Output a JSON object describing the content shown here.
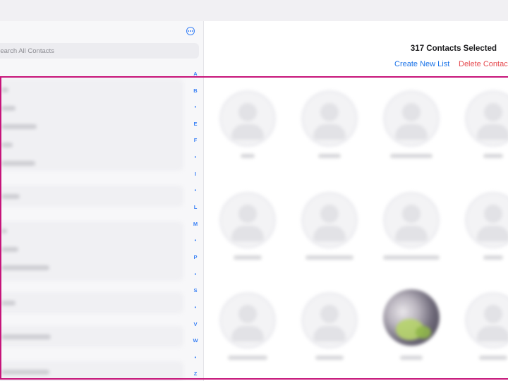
{
  "sidebar": {
    "search_placeholder": "Search All Contacts",
    "index_letters": [
      "A",
      "B",
      "•",
      "E",
      "F",
      "•",
      "I",
      "•",
      "L",
      "M",
      "•",
      "P",
      "•",
      "S",
      "•",
      "V",
      "W",
      "•",
      "Z"
    ]
  },
  "selection": {
    "count_text": "317 Contacts Selected",
    "create_list_label": "Create New List",
    "delete_label": "Delete Contacts"
  },
  "colors": {
    "accent": "#1a73e8",
    "danger": "#e5484d",
    "highlight": "#c7157a"
  }
}
